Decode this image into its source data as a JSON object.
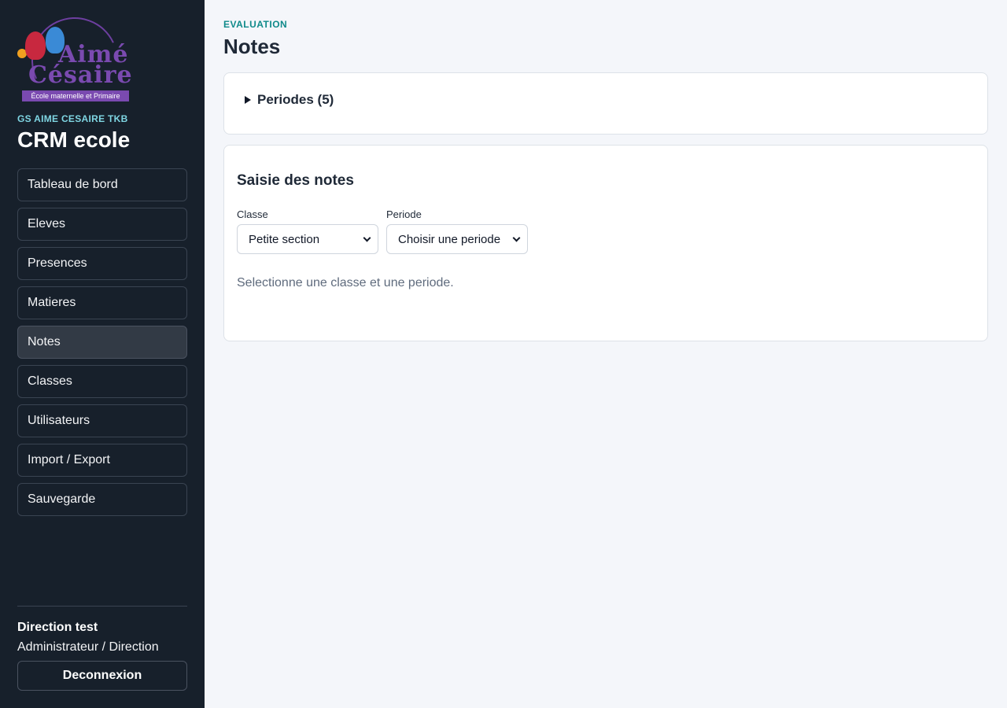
{
  "sidebar": {
    "logo": {
      "line1": "Aimé",
      "line2": "Césaire",
      "tagline": "École maternelle et Primaire"
    },
    "school_name": "GS AIME CESAIRE TKB",
    "app_title": "CRM ecole",
    "items": [
      {
        "label": "Tableau de bord"
      },
      {
        "label": "Eleves"
      },
      {
        "label": "Presences"
      },
      {
        "label": "Matieres"
      },
      {
        "label": "Notes"
      },
      {
        "label": "Classes"
      },
      {
        "label": "Utilisateurs"
      },
      {
        "label": "Import / Export"
      },
      {
        "label": "Sauvegarde"
      }
    ],
    "active_item": "Notes",
    "user": {
      "name": "Direction test",
      "role": "Administrateur / Direction",
      "logout_label": "Deconnexion"
    }
  },
  "main": {
    "eyebrow": "EVALUATION",
    "title": "Notes",
    "periods": {
      "summary": "Periodes (5)"
    },
    "entry": {
      "title": "Saisie des notes",
      "class_label": "Classe",
      "class_value": "Petite section",
      "period_label": "Periode",
      "period_value": "Choisir une periode",
      "hint": "Selectionne une classe et une periode."
    }
  },
  "colors": {
    "sidebar_bg": "#17202b",
    "accent_teal": "#0f8a8a",
    "school_cyan": "#7fd6e3",
    "brand_purple": "#7a4ab0"
  }
}
